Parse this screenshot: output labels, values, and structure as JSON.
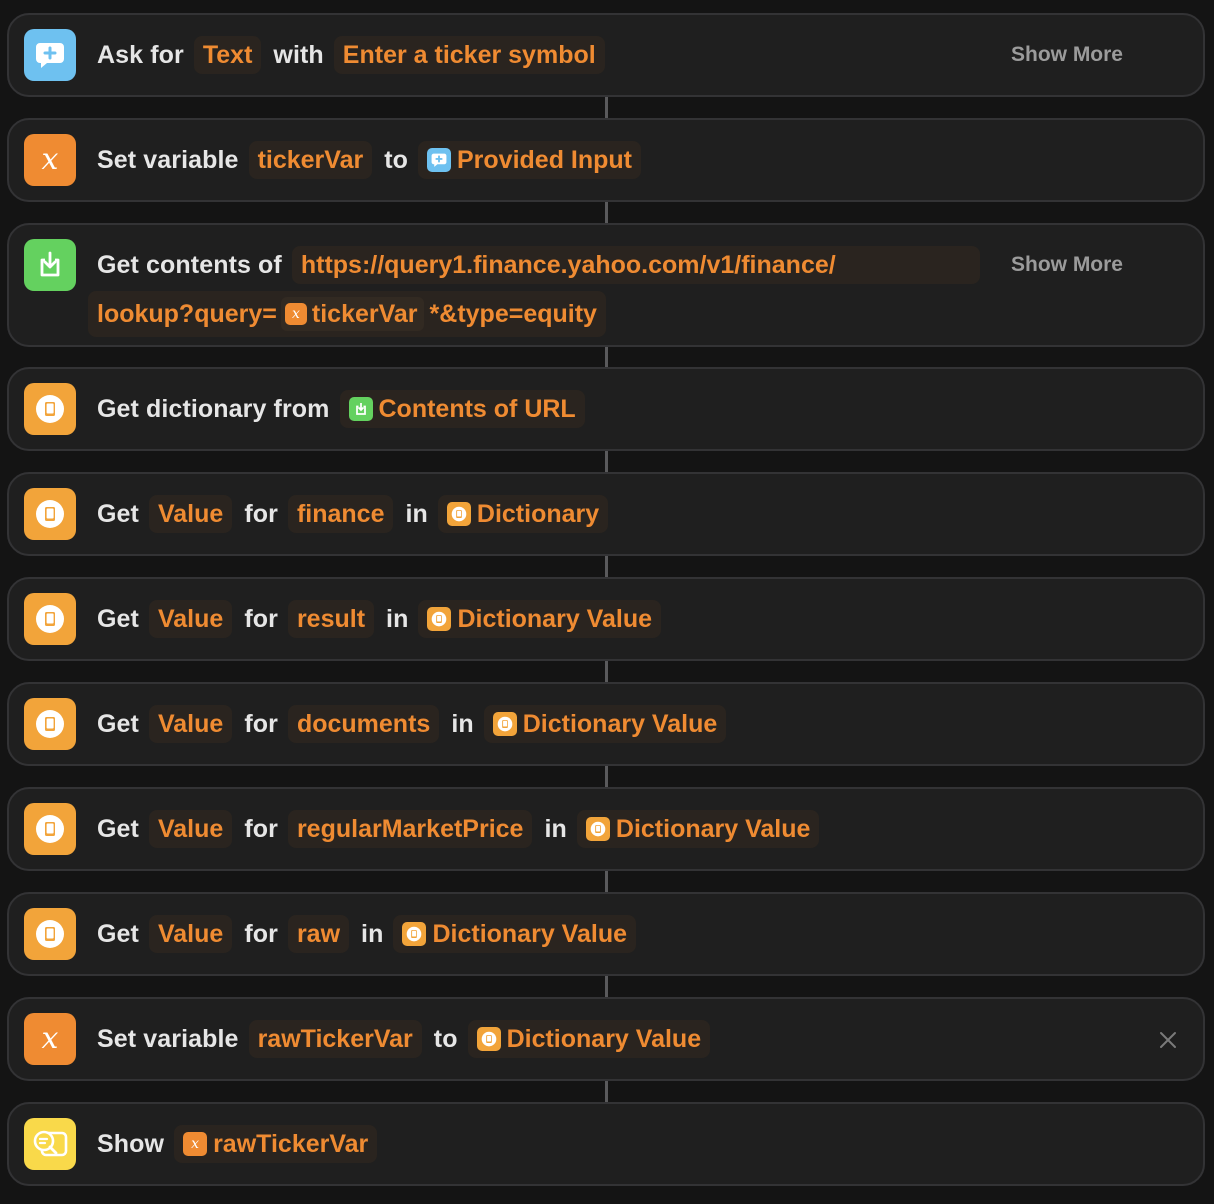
{
  "colors": {
    "background": "#141414",
    "card": "#1f1f1f",
    "token_text": "#ef8b32",
    "ask_icon": "#6ec1f0",
    "variable_icon": "#ef8b32",
    "dictionary_icon": "#f2a43a",
    "url_icon": "#64d15f",
    "show_icon": "#f9d94a"
  },
  "actions": [
    {
      "type": "ask-for-input",
      "icon": "chat-bubble-plus-icon",
      "words": [
        "Ask for",
        "with"
      ],
      "tokens": [
        {
          "label": "Text"
        },
        {
          "label": "Enter a ticker symbol"
        }
      ],
      "show_more": "Show More"
    },
    {
      "type": "set-variable",
      "icon": "variable-x-icon",
      "words": [
        "Set variable",
        "to"
      ],
      "tokens": [
        {
          "label": "tickerVar"
        },
        {
          "label": "Provided Input",
          "icon": "chat-bubble-plus-icon"
        }
      ]
    },
    {
      "type": "get-contents-of-url",
      "icon": "download-tray-icon",
      "words": [
        "Get contents of"
      ],
      "url": {
        "line1": "https://query1.finance.yahoo.com/v1/finance/",
        "line2_prefix": "lookup?query=",
        "variable": "tickerVar",
        "line2_suffix": "*&type=equity"
      },
      "show_more": "Show More"
    },
    {
      "type": "get-dictionary",
      "icon": "book-icon",
      "words": [
        "Get dictionary from"
      ],
      "tokens": [
        {
          "label": "Contents of URL",
          "icon": "download-tray-icon"
        }
      ]
    },
    {
      "type": "get-dictionary-value",
      "icon": "book-icon",
      "words": [
        "Get",
        "for",
        "in"
      ],
      "tokens": [
        {
          "label": "Value"
        },
        {
          "label": "finance"
        },
        {
          "label": "Dictionary",
          "icon": "book-icon"
        }
      ]
    },
    {
      "type": "get-dictionary-value",
      "icon": "book-icon",
      "words": [
        "Get",
        "for",
        "in"
      ],
      "tokens": [
        {
          "label": "Value"
        },
        {
          "label": "result"
        },
        {
          "label": "Dictionary Value",
          "icon": "book-icon"
        }
      ]
    },
    {
      "type": "get-dictionary-value",
      "icon": "book-icon",
      "words": [
        "Get",
        "for",
        "in"
      ],
      "tokens": [
        {
          "label": "Value"
        },
        {
          "label": "documents"
        },
        {
          "label": "Dictionary Value",
          "icon": "book-icon"
        }
      ]
    },
    {
      "type": "get-dictionary-value",
      "icon": "book-icon",
      "words": [
        "Get",
        "for",
        "in"
      ],
      "tokens": [
        {
          "label": "Value"
        },
        {
          "label": "regularMarketPrice"
        },
        {
          "label": "Dictionary Value",
          "icon": "book-icon"
        }
      ]
    },
    {
      "type": "get-dictionary-value",
      "icon": "book-icon",
      "words": [
        "Get",
        "for",
        "in"
      ],
      "tokens": [
        {
          "label": "Value"
        },
        {
          "label": "raw"
        },
        {
          "label": "Dictionary Value",
          "icon": "book-icon"
        }
      ]
    },
    {
      "type": "set-variable",
      "icon": "variable-x-icon",
      "words": [
        "Set variable",
        "to"
      ],
      "tokens": [
        {
          "label": "rawTickerVar"
        },
        {
          "label": "Dictionary Value",
          "icon": "book-icon"
        }
      ],
      "close_icon": "close-icon"
    },
    {
      "type": "show-result",
      "icon": "quick-look-icon",
      "words": [
        "Show"
      ],
      "tokens": [
        {
          "label": "rawTickerVar",
          "icon": "variable-x-icon"
        }
      ]
    }
  ],
  "glyphs": {
    "variable": "x"
  }
}
